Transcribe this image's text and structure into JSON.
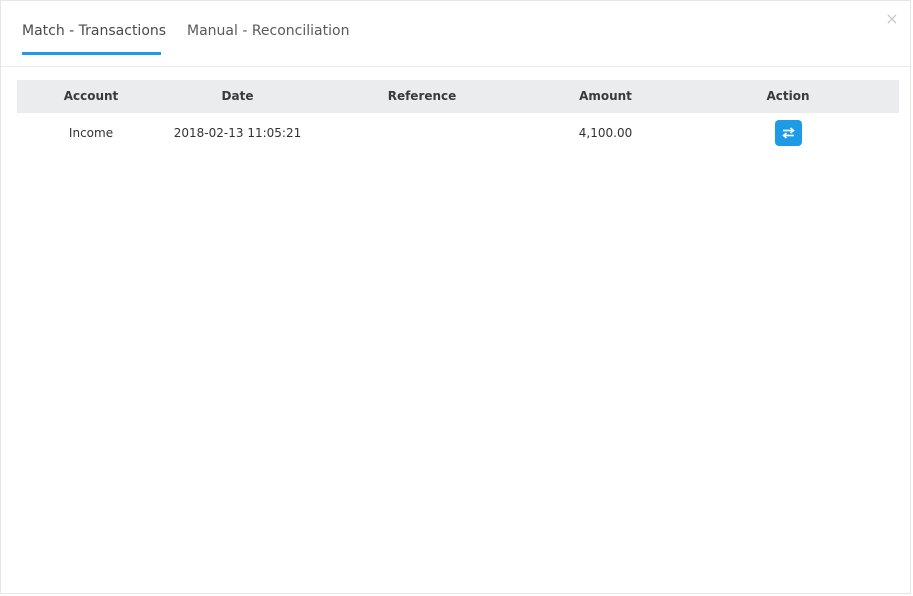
{
  "dialog": {
    "close_glyph": "×",
    "tabs": [
      {
        "label": "Match - Transactions",
        "active": true
      },
      {
        "label": "Manual - Reconciliation",
        "active": false
      }
    ]
  },
  "table": {
    "headers": {
      "account": "Account",
      "date": "Date",
      "reference": "Reference",
      "amount": "Amount",
      "action": "Action"
    },
    "rows": [
      {
        "account": "Income",
        "date": "2018-02-13 11:05:21",
        "reference": "",
        "amount": "4,100.00",
        "action_icon": "exchange-arrows-icon"
      }
    ]
  },
  "colors": {
    "accent": "#1e9be6",
    "header_bg": "#eaecee"
  }
}
